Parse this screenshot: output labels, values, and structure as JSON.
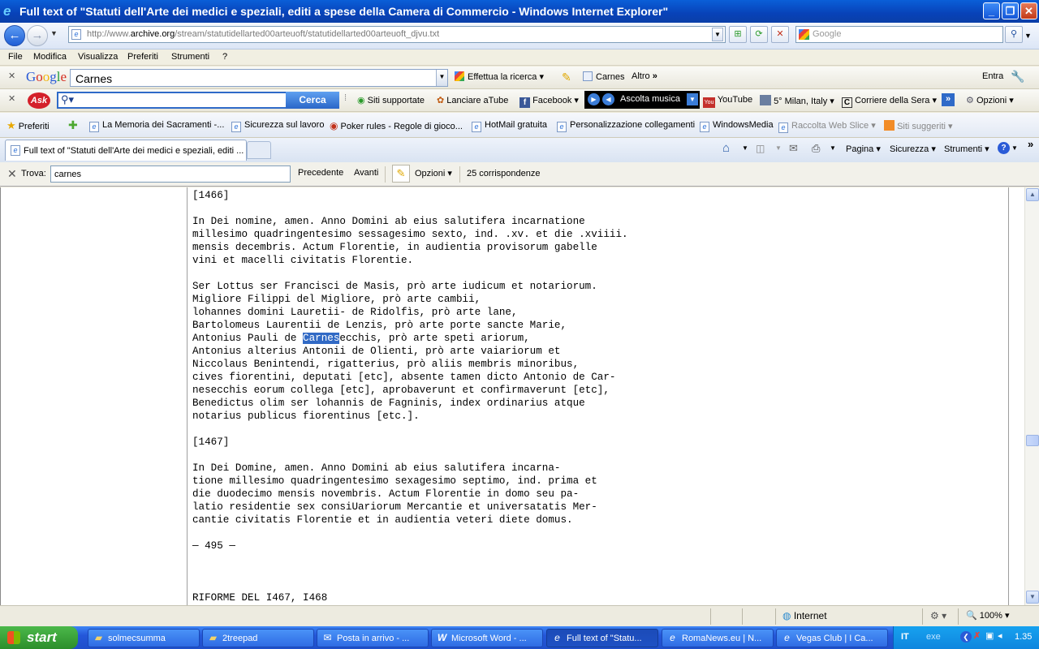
{
  "window": {
    "title": "Full text of \"Statuti dell'Arte dei medici e speziali, editi a spese della Camera di Commercio  - Windows Internet Explorer\""
  },
  "address": {
    "url_prefix": "http://www.",
    "url_host": "archive.org",
    "url_path": "/stream/statutidellarted00arteuoft/statutidellarted00arteuoft_djvu.txt",
    "search_placeholder": "Google"
  },
  "menu": [
    "File",
    "Modifica",
    "Visualizza",
    "Preferiti",
    "Strumenti",
    "?"
  ],
  "google_toolbar": {
    "logo": "Google",
    "query": "Carnes",
    "search_btn": "Effettua la ricerca",
    "highlight_term": "Carnes",
    "more": "Altro",
    "signin": "Entra"
  },
  "ask_toolbar": {
    "logo": "Ask",
    "search_btn": "Cerca",
    "items": [
      "Siti supportate",
      "Lanciare aTube",
      "Facebook"
    ],
    "music": "Ascolta musica",
    "youtube": "YouTube",
    "weather": "5° Milan, Italy",
    "news": "Corriere della Sera",
    "options": "Opzioni"
  },
  "favorites": {
    "label": "Preferiti",
    "items": [
      "La Memoria dei Sacramenti -...",
      "Sicurezza sul lavoro",
      "Poker rules - Regole di gioco...",
      "HotMail gratuita",
      "Personalizzazione collegamenti",
      "WindowsMedia",
      "Raccolta Web Slice",
      "Siti suggeriti"
    ]
  },
  "tabs": {
    "active": "Full text of \"Statuti dell'Arte dei medici e speziali, editi ..."
  },
  "command_bar": [
    "Pagina",
    "Sicurezza",
    "Strumenti"
  ],
  "findbar": {
    "label": "Trova:",
    "value": "carnes",
    "prev": "Precedente",
    "next": "Avanti",
    "options": "Opzioni",
    "matches": "25 corrispondenze"
  },
  "document": {
    "before_highlight": "[1466]\n\nIn Dei nomine, amen. Anno Domini ab eius salutifera incarnatione\nmillesimo quadringentesimo sessagesimo sexto, ind. .xv. et die .xviiii.\nmensis decembris. Actum Florentie, in audientia provisorum gabelle\nvini et macelli civitatis Florentie.\n\nSer Lottus ser Francisci de Masis, prò arte iudicum et notariorum.\nMigliore Filippi del Migliore, prò arte cambii,\nlohannes domini Lauretii- de Ridolfìs, prò arte lane,\nBartolomeus Laurentii de Lenzis, prò arte porte sancte Marie,\nAntonius Pauli de ",
    "highlight": "Carnes",
    "after_highlight": "ecchis, prò arte speti ariorum,\nAntonius alterius Antonii de Olienti, prò arte vaiariorum et\nNiccolaus Benintendi, rigatterius, prò aliis membris minoribus,\ncives fiorentini, deputati [etc], absente tamen dicto Antonio de Car-\nnesecchis eorum collega [etc], aprobaverunt et confìrmaverunt [etc],\nBenedictus olim ser lohannis de Fagninis, index ordinarius atque\nnotarius publicus fiorentinus [etc.].\n\n[1467]\n\nIn Dei Domine, amen. Anno Domini ab eius salutifera incarna-\ntione millesimo quadringentesimo sexagesimo septimo, ind. prima et\ndie duodecimo mensis novembris. Actum Florentie in domo seu pa-\nlatio residentie sex consiUariorum Mercantie et universatatis Mer-\ncantie civitatis Florentie et in audientia veteri diete domus.\n\n— 495 —\n\n\n\nRIFORME DEL I467, I468"
  },
  "status": {
    "zone": "Internet",
    "zoom": "100%"
  },
  "taskbar": {
    "start": "start",
    "tasks": [
      "solmecsumma",
      "2treepad",
      "Posta in arrivo - ...",
      "Microsoft Word - ...",
      "Full text of \"Statu...",
      "RomaNews.eu | N...",
      "Vegas Club | I Ca..."
    ],
    "lang": "IT",
    "tray_text": "exe",
    "clock": "1.35"
  },
  "colors": {
    "titlebar": "#0A5FD8",
    "highlight": "#316AC5",
    "taskbar": "#2457D9",
    "start": "#2C8E2B"
  }
}
